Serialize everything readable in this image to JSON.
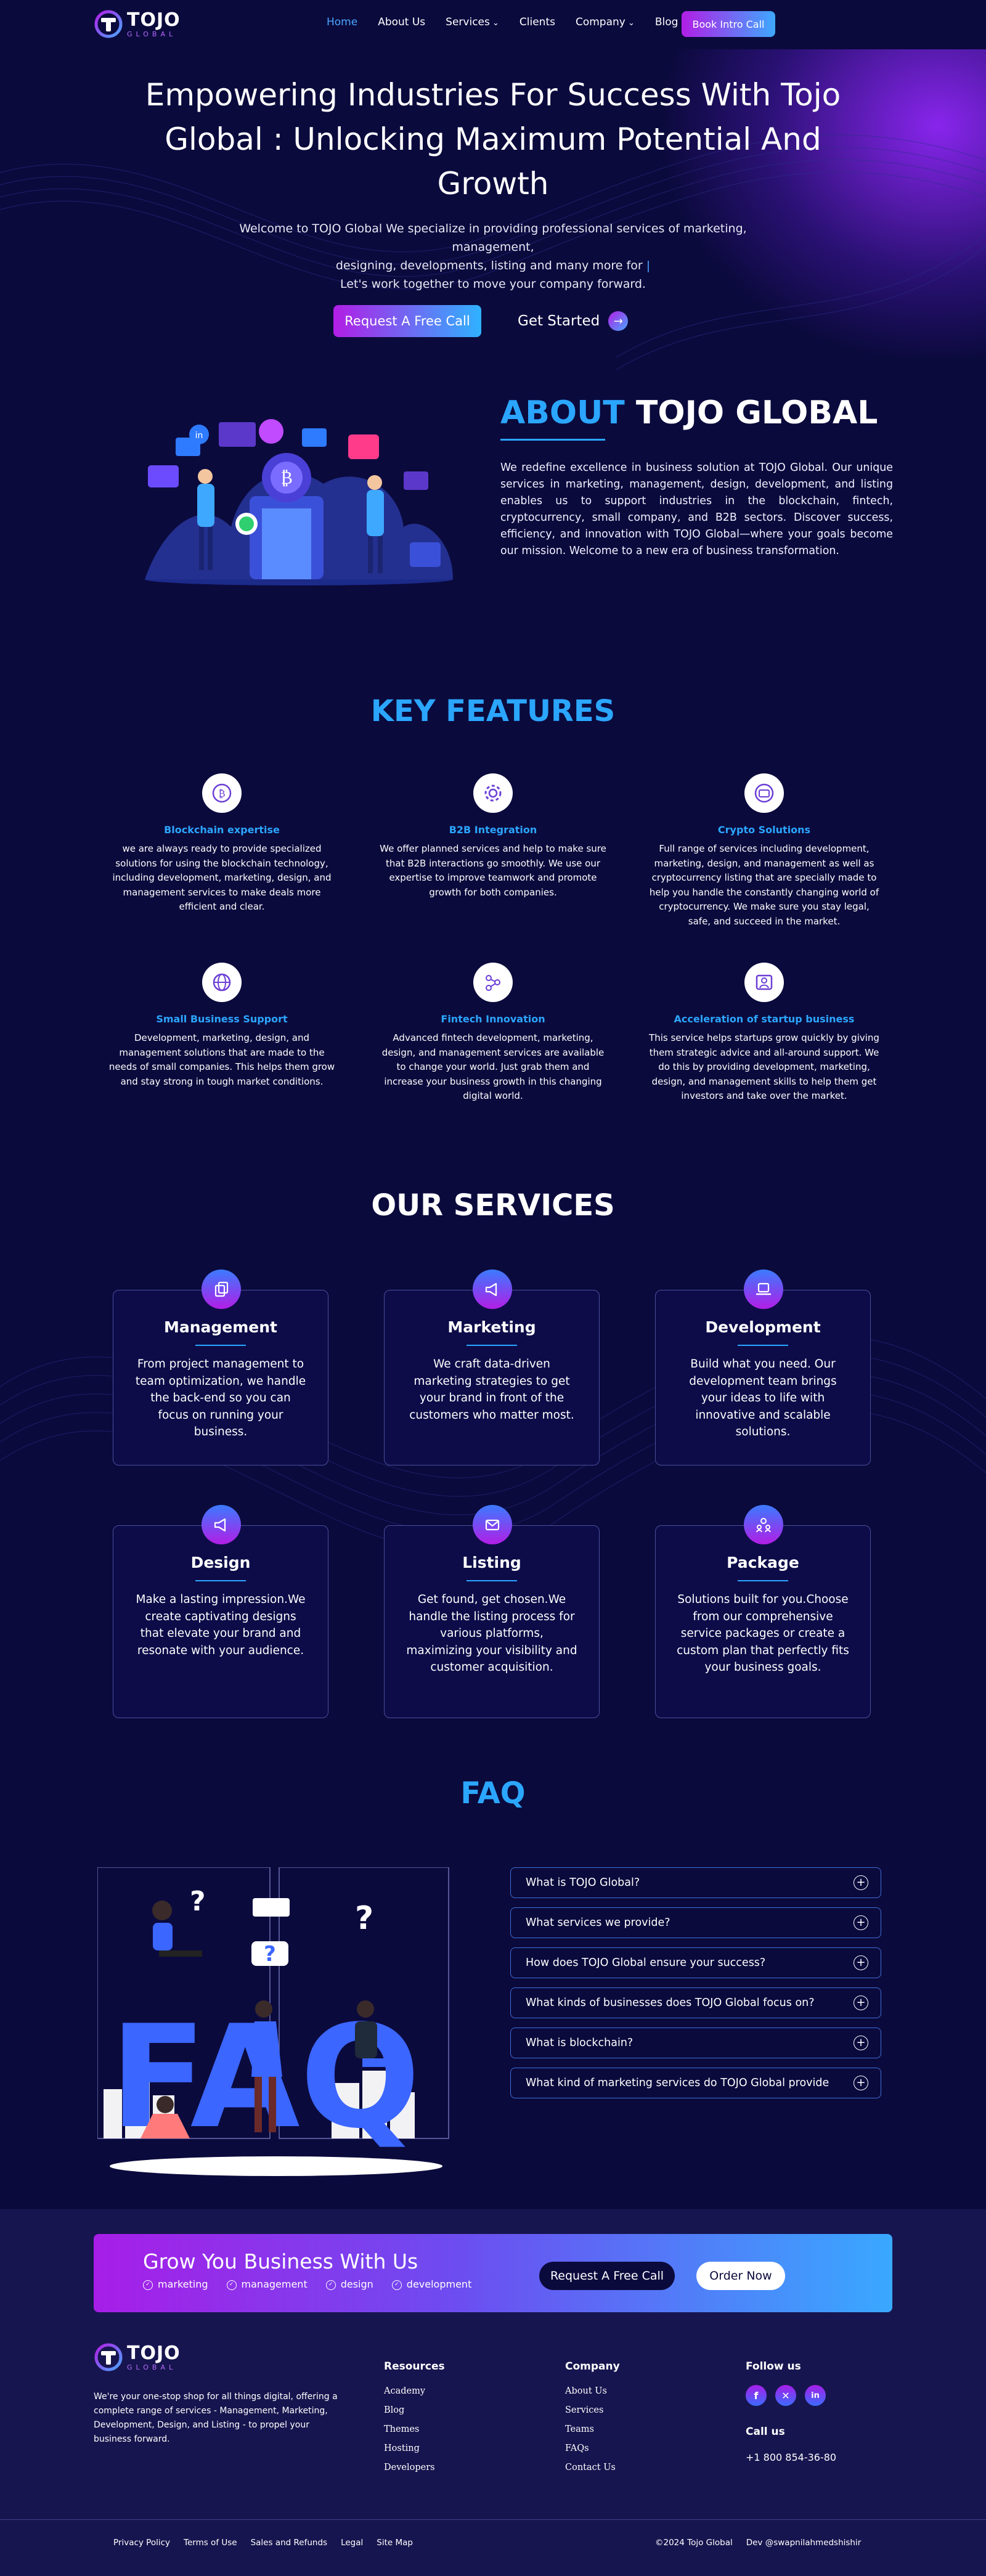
{
  "nav": {
    "logo_main": "TOJO",
    "logo_sub": "GLOBAL",
    "items": [
      {
        "label": "Home"
      },
      {
        "label": "About Us"
      },
      {
        "label": "Services"
      },
      {
        "label": "Clients"
      },
      {
        "label": "Company"
      },
      {
        "label": "Blog"
      }
    ],
    "cta": "Book Intro Call"
  },
  "hero": {
    "title_line1": "Empowering Industries For Success With Tojo",
    "title_line2": "Global : Unlocking Maximum Potential And",
    "title_line3": "Growth",
    "sub_line1": "Welcome to TOJO Global We specialize in providing professional services of marketing, management,",
    "sub_line2": "designing, developments, listing and many more for",
    "sub_line3": "Let's work together to move your company forward.",
    "btn_primary": "Request A Free Call",
    "btn_secondary": "Get Started"
  },
  "about": {
    "title_hl": "ABOUT",
    "title_rest": "TOJO GLOBAL",
    "text": "We redefine excellence in business solution at TOJO Global. Our unique services in marketing, management, design, development, and listing enables us to support industries in the blockchain, fintech, cryptocurrency, small company, and B2B sectors. Discover success, efficiency, and innovation with TOJO Global—where your goals become our mission. Welcome to a new era of business transformation."
  },
  "features": {
    "title": "KEY FEATURES",
    "items": [
      {
        "title": "Blockchain expertise",
        "icon": "bitcoin-icon",
        "text": "we are always ready to provide specialized solutions for using the blockchain technology, including development, marketing, design, and management services to make deals more efficient and clear."
      },
      {
        "title": "B2B Integration",
        "icon": "gear-icon",
        "text": "We offer planned services and help to make sure that B2B interactions go smoothly. We use our expertise to improve teamwork and promote growth for both companies."
      },
      {
        "title": "Crypto Solutions",
        "icon": "wallet-icon",
        "text": "Full range of services including development, marketing, design, and management as well as cryptocurrency listing that are specially made to help you handle the constantly changing world of cryptocurrency. We make sure you stay legal, safe, and succeed in the market."
      },
      {
        "title": "Small Business Support",
        "icon": "globe-icon",
        "text": "Development, marketing, design, and management solutions that are made to the needs of small companies. This helps them grow and stay strong in tough market conditions."
      },
      {
        "title": "Fintech Innovation",
        "icon": "network-icon",
        "text": "Advanced fintech development, marketing, design, and management services are available to change your world. Just grab them and increase your business growth in this changing digital world."
      },
      {
        "title": "Acceleration of startup business",
        "icon": "startup-icon",
        "text": "This service helps startups grow quickly by giving them strategic advice and all-around support. We do this by providing development, marketing, design, and management skills to help them get investors and take over the market."
      }
    ]
  },
  "services": {
    "title": "OUR SERVICES",
    "items": [
      {
        "title": "Management",
        "icon": "copy-icon",
        "text": "From project management to team optimization, we handle the back-end so you can focus on running your business."
      },
      {
        "title": "Marketing",
        "icon": "megaphone-icon",
        "text": "We craft data-driven marketing strategies to get your brand in front of the customers who matter most."
      },
      {
        "title": "Development",
        "icon": "laptop-icon",
        "text": "Build what you need. Our development team brings your ideas to life with innovative and scalable solutions."
      },
      {
        "title": "Design",
        "icon": "megaphone-icon",
        "text": "Make a lasting impression.We create captivating designs that elevate your brand and resonate with your audience."
      },
      {
        "title": "Listing",
        "icon": "mail-icon",
        "text": "Get found, get chosen.We handle the listing process for various platforms, maximizing your visibility and customer acquisition."
      },
      {
        "title": "Package",
        "icon": "team-icon",
        "text": "Solutions built for you.Choose from our comprehensive service packages or create a custom plan that perfectly fits your business goals."
      }
    ]
  },
  "faq": {
    "title": "FAQ",
    "items": [
      {
        "q": "What is TOJO Global?"
      },
      {
        "q": "What services we provide?"
      },
      {
        "q": "How does TOJO Global ensure your success?"
      },
      {
        "q": "What kinds of businesses does TOJO Global focus on?"
      },
      {
        "q": "What is blockchain?"
      },
      {
        "q": "What kind of marketing services do TOJO Global provide"
      }
    ]
  },
  "cta": {
    "title": "Grow You Business With Us",
    "tags": [
      "marketing",
      "management",
      "design",
      "development"
    ],
    "btn_primary": "Request A Free Call",
    "btn_secondary": "Order Now"
  },
  "footer": {
    "desc": "We're your one-stop shop for all things digital, offering a complete range of services - Management, Marketing, Development, Design, and Listing - to propel your business forward.",
    "resources_title": "Resources",
    "resources": [
      "Academy",
      "Blog",
      "Themes",
      "Hosting",
      "Developers"
    ],
    "company_title": "Company",
    "company": [
      "About Us",
      "Services",
      "Teams",
      "FAQs",
      "Contact Us"
    ],
    "follow_title": "Follow us",
    "call_title": "Call us",
    "phone": "+1 800 854-36-80",
    "bottom_links": [
      "Privacy Policy",
      "Terms of Use",
      "Sales and Refunds",
      "Legal",
      "Site Map"
    ],
    "copyright": "©2024 Tojo Global",
    "dev_credit": "Dev @swapnilahmedshishir"
  },
  "colors": {
    "bg": "#0b0a3d",
    "accent_blue": "#2ba6ff",
    "accent_purple": "#b21ee6",
    "footer_bg": "#17154f"
  }
}
